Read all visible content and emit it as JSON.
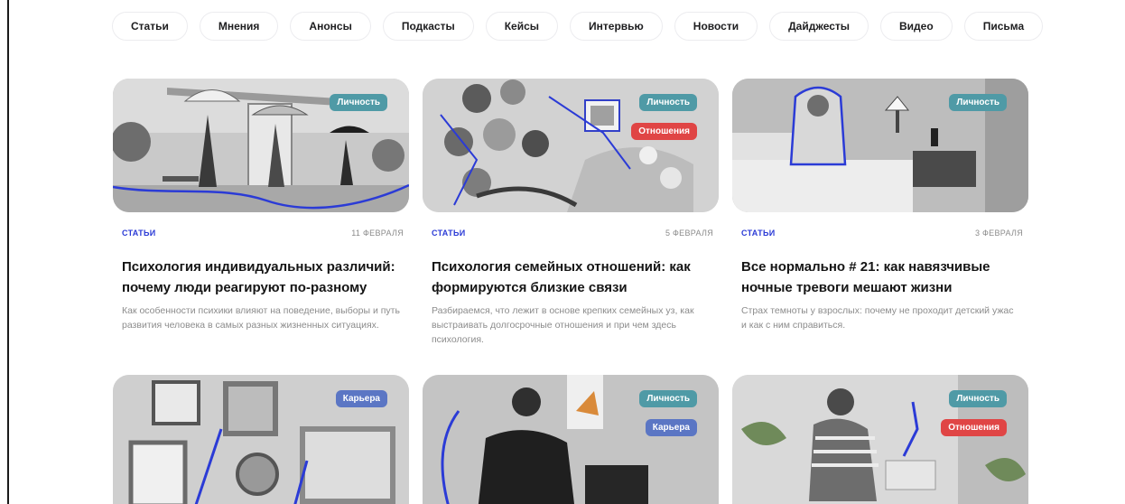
{
  "colors": {
    "accent": "#2b3bd6",
    "tag_lichnost": "#4f9aa6",
    "tag_otnosheniya": "#e04545",
    "tag_karera": "#5b76c4"
  },
  "filters": [
    "Статьи",
    "Мнения",
    "Анонсы",
    "Подкасты",
    "Кейсы",
    "Интервью",
    "Новости",
    "Дайджесты",
    "Видео",
    "Письма"
  ],
  "cards": [
    {
      "tags": [
        {
          "label": "Личность",
          "color": "#4f9aa6"
        }
      ],
      "category": "СТАТЬИ",
      "date": "11 ФЕВРАЛЯ",
      "title": "Психология индивидуальных различий: почему люди реагируют по-разному",
      "description": "Как особенности психики влияют на поведение, выборы и путь развития человека в самых разных жизненных ситуациях."
    },
    {
      "tags": [
        {
          "label": "Личность",
          "color": "#4f9aa6"
        },
        {
          "label": "Отношения",
          "color": "#e04545"
        }
      ],
      "category": "СТАТЬИ",
      "date": "5 ФЕВРАЛЯ",
      "title": "Психология семейных отношений: как формируются близкие связи",
      "description": "Разбираемся, что лежит в основе крепких семейных уз, как выстраивать долгосрочные отношения и при чем здесь психология."
    },
    {
      "tags": [
        {
          "label": "Личность",
          "color": "#4f9aa6"
        }
      ],
      "category": "СТАТЬИ",
      "date": "3 ФЕВРАЛЯ",
      "title": "Все нормально # 21: как навязчивые ночные тревоги мешают жизни",
      "description": "Страх темноты у взрослых: почему не проходит детский ужас и как с ним справиться."
    },
    {
      "tags": [
        {
          "label": "Карьера",
          "color": "#5b76c4"
        }
      ]
    },
    {
      "tags": [
        {
          "label": "Личность",
          "color": "#4f9aa6"
        },
        {
          "label": "Карьера",
          "color": "#5b76c4"
        }
      ]
    },
    {
      "tags": [
        {
          "label": "Личность",
          "color": "#4f9aa6"
        },
        {
          "label": "Отношения",
          "color": "#e04545"
        }
      ]
    }
  ]
}
